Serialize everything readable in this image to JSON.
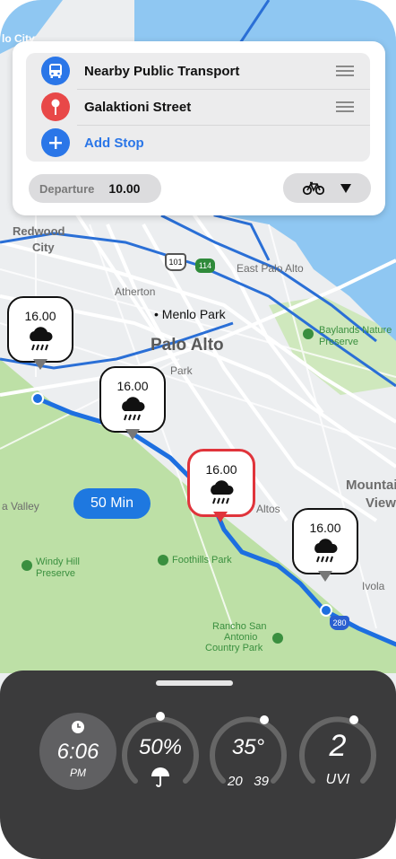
{
  "map": {
    "place_labels": [
      "Redwood",
      "City",
      "Atherton",
      "Menlo Park",
      "Palo Alto",
      "East Palo Alto",
      "Baylands Nature",
      "Preserve",
      "Mountain",
      "View",
      "Altos",
      "a Valley",
      "Windy Hill",
      "Preserve",
      "Foothills Park",
      "Rancho San",
      "Antonio",
      "Country Park",
      "lo City",
      "Ivola",
      "Park"
    ],
    "road_shields": [
      "101",
      "114",
      "280"
    ],
    "colors": {
      "water": "#8fc7f2",
      "park": "#bde0a6",
      "route": "#1d6fe0",
      "road": "#ffffff"
    }
  },
  "route_card": {
    "stops": [
      {
        "label": "Nearby Public Transport",
        "icon": "bus-icon",
        "color": "#2a76e8"
      },
      {
        "label": "Galaktioni Street",
        "icon": "pin-icon",
        "color": "#e84848"
      },
      {
        "label": "Add Stop",
        "icon": "plus-icon",
        "color": "#2a76e8"
      }
    ],
    "departure_label": "Departure",
    "departure_time": "10.00",
    "mode_icon": "bicycle-icon"
  },
  "weather_pins": [
    {
      "time": "16.00",
      "icon": "rain-cloud-icon",
      "highlighted": false
    },
    {
      "time": "16.00",
      "icon": "rain-cloud-icon",
      "highlighted": false
    },
    {
      "time": "16.00",
      "icon": "rain-cloud-icon",
      "highlighted": true
    },
    {
      "time": "16.00",
      "icon": "rain-cloud-icon",
      "highlighted": false
    }
  ],
  "eta_label": "50 Min",
  "stats": {
    "time": "6:06",
    "ampm": "PM",
    "humidity": "50%",
    "temperature": "35°",
    "temp_low": "20",
    "temp_high": "39",
    "uv": "2",
    "uv_label": "UVI"
  }
}
